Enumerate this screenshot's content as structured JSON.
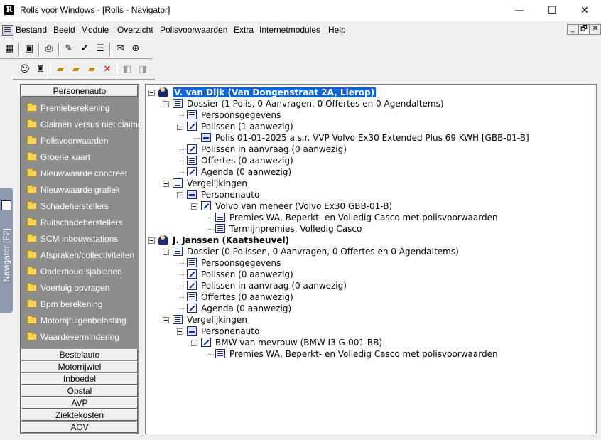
{
  "window": {
    "title": "Rolls voor Windows - [Rolls - Navigator]",
    "app_icon_letter": "R",
    "minimize": "—",
    "maximize": "☐",
    "close": "✕"
  },
  "menu": {
    "items": [
      "Bestand",
      "Beeld",
      "Module",
      "Overzicht",
      "Polisvoorwaarden",
      "Extra",
      "Internetmodules",
      "Help"
    ],
    "mdi_min": "_",
    "mdi_restore": "🗗",
    "mdi_close": "✕"
  },
  "navigator_tab": {
    "label": "Navigator  [F2]"
  },
  "left_panel": {
    "active_category": "Personenauto",
    "items": [
      "Premieberekening",
      "Claimen versus niet claimen",
      "Polisvoorwaarden",
      "Groene kaart",
      "Nieuwwaarde concreet",
      "Nieuwwaarde grafiek",
      "Schadeherstellers",
      "Ruitschadeherstellers",
      "SCM inbouwstations",
      "Afspraken/collectiviteiten",
      "Onderhoud sjablonen",
      "Voertuig opvragen",
      "Bpm berekening",
      "Motorrijtuigenbelasting",
      "Waardevermindering"
    ],
    "categories": [
      "Bestelauto",
      "Motorrijwiel",
      "Inboedel",
      "Opstal",
      "AVP",
      "Ziektekosten",
      "AOV"
    ]
  },
  "tree": {
    "rows": [
      "V. van Dijk (Van Dongenstraat 2A, Lierop)",
      "Dossier (1 Polis, 0 Aanvragen, 0 Offertes en 0 AgendaItems)",
      "Persoonsgegevens",
      "Polissen (1 aanwezig)",
      "Polis 01-01-2025 a.s.r. VVP Volvo Ex30 Extended Plus 69 KWH [GBB-01-B]",
      "Polissen in aanvraag (0 aanwezig)",
      "Offertes (0 aanwezig)",
      "Agenda (0 aanwezig)",
      "Vergelijkingen",
      "Personenauto",
      "Volvo van meneer (Volvo Ex30 GBB-01-B)",
      "Premies WA, Beperkt- en Volledig Casco met polisvoorwaarden",
      "Termijnpremies, Volledig Casco",
      "J. Janssen (Kaatsheuvel)",
      "Dossier (0 Polissen, 0 Aanvragen, 0 Offertes en 0 AgendaItems)",
      "Persoonsgegevens",
      "Polissen (0 aanwezig)",
      "Polissen in aanvraag (0 aanwezig)",
      "Offertes (0 aanwezig)",
      "Agenda (0 aanwezig)",
      "Vergelijkingen",
      "Personenauto",
      "BMW van mevrouw (BMW I3 G-001-BB)",
      "Premies WA, Beperkt- en Volledig Casco met polisvoorwaarden"
    ]
  }
}
